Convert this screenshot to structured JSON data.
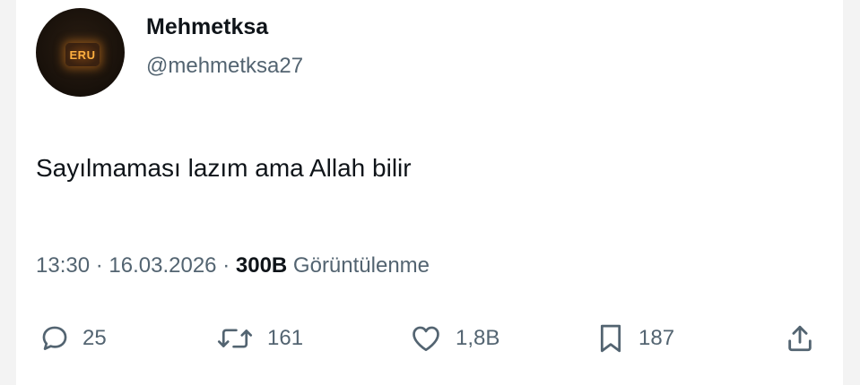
{
  "author": {
    "avatar_text": "ERU",
    "display_name": "Mehmetksa",
    "handle": "@mehmetksa27"
  },
  "tweet": {
    "text": "Sayılmaması lazım ama Allah bilir",
    "time": "13:30",
    "separator": "·",
    "date": "16.03.2026",
    "views_count": "300B",
    "views_label": "Görüntülenme"
  },
  "actions": {
    "reply": {
      "icon": "reply-icon",
      "count": "25"
    },
    "retweet": {
      "icon": "retweet-icon",
      "count": "161"
    },
    "like": {
      "icon": "heart-icon",
      "count": "1,8B"
    },
    "bookmark": {
      "icon": "bookmark-icon",
      "count": "187"
    },
    "share": {
      "icon": "share-icon"
    }
  },
  "colors": {
    "text_primary": "#0f1419",
    "text_secondary": "#536471",
    "background": "#ffffff"
  }
}
